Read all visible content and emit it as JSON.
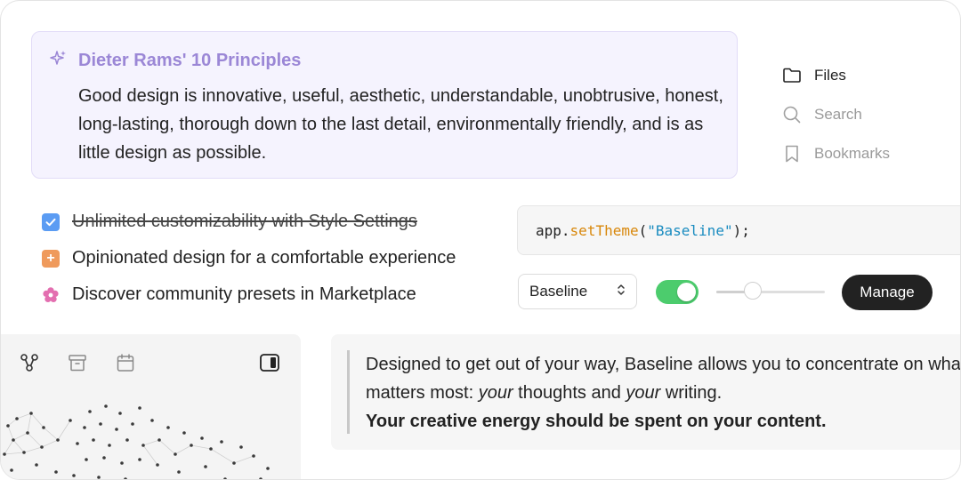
{
  "callout": {
    "title": "Dieter Rams' 10 Principles",
    "body": "Good design is innovative, useful, aesthetic, understandable, unobtrusive, honest, long-lasting, thorough down to the last detail, environmentally friendly, and is as little design as possible.",
    "icon": "sparkle-icon",
    "accent_color": "#9b87d6",
    "background_color": "#f5f3fe"
  },
  "nav": {
    "items": [
      {
        "label": "Files",
        "icon": "folder-icon",
        "active": true
      },
      {
        "label": "Search",
        "icon": "search-icon",
        "active": false
      },
      {
        "label": "Bookmarks",
        "icon": "bookmark-icon",
        "active": false
      }
    ]
  },
  "checklist": {
    "items": [
      {
        "label": "Unlimited customizability with Style Settings",
        "icon": "checkbox-checked-icon",
        "done": true
      },
      {
        "label": "Opinionated design for a comfortable experience",
        "icon": "plus-square-icon",
        "done": false
      },
      {
        "label": "Discover community presets in Marketplace",
        "icon": "flower-icon",
        "done": false
      }
    ]
  },
  "code": {
    "object": "app",
    "dot": ".",
    "method": "setTheme",
    "open": "(",
    "string": "\"Baseline\"",
    "close": ");"
  },
  "controls": {
    "select_value": "Baseline",
    "toggle_on": true,
    "slider_value": 0.3,
    "manage_label": "Manage",
    "toggle_color": "#4ccc6d"
  },
  "panel": {
    "icons": [
      "graph-icon",
      "archive-icon",
      "calendar-icon"
    ],
    "toggle_icon": "sidebar-toggle-icon"
  },
  "quote": {
    "line1": "Designed to get out of your way, Baseline allows you to concentrate on what",
    "line2_pre": "matters most: ",
    "line2_em1": "your",
    "line2_mid": " thoughts and ",
    "line2_em2": "your",
    "line2_post": " writing.",
    "line3": "Your creative energy should be spent on your content."
  }
}
